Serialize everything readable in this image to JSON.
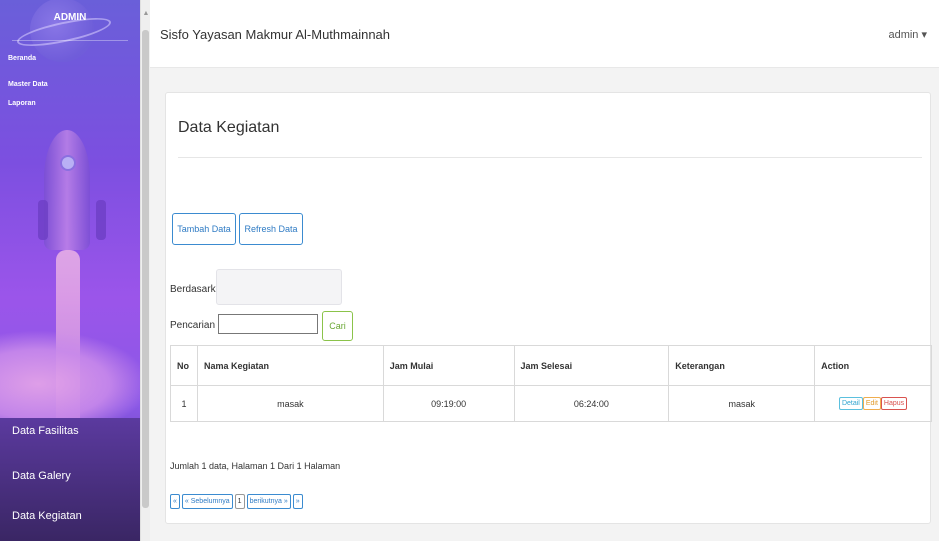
{
  "sidebar": {
    "title": "ADMIN",
    "top_links": [
      "Beranda",
      "Master Data",
      "Laporan"
    ],
    "bottom_links": [
      "Data Fasilitas",
      "Data Galery",
      "Data Kegiatan"
    ]
  },
  "header": {
    "app_title": "Sisfo Yayasan Makmur Al-Muthmainnah",
    "user_label": "admin ▾"
  },
  "page": {
    "title": "Data Kegiatan",
    "buttons": {
      "add": "Tambah Data",
      "refresh": "Refresh Data"
    },
    "filter": {
      "by_label": "Berdasarkan:",
      "search_label": "Pencarian :",
      "search_value": "",
      "search_button": "Cari"
    },
    "table": {
      "headers": [
        "No",
        "Nama Kegiatan",
        "Jam Mulai",
        "Jam Selesai",
        "Keterangan",
        "Action"
      ],
      "rows": [
        {
          "no": "1",
          "nama": "masak",
          "mulai": "09:19:00",
          "selesai": "06:24:00",
          "keterangan": "masak"
        }
      ],
      "actions": {
        "detail": "Detail",
        "edit": "Edit",
        "hapus": "Hapus"
      }
    },
    "summary": "Jumlah 1 data, Halaman 1 Dari 1 Halaman",
    "pager": {
      "first": "«",
      "prev": "« Sebelumnya",
      "current": "1",
      "next": "berikutnya »",
      "last": "»"
    }
  },
  "colors": {
    "primary": "#2f7bc4",
    "success": "#6aa734",
    "sidebar": "#8a58e6"
  }
}
